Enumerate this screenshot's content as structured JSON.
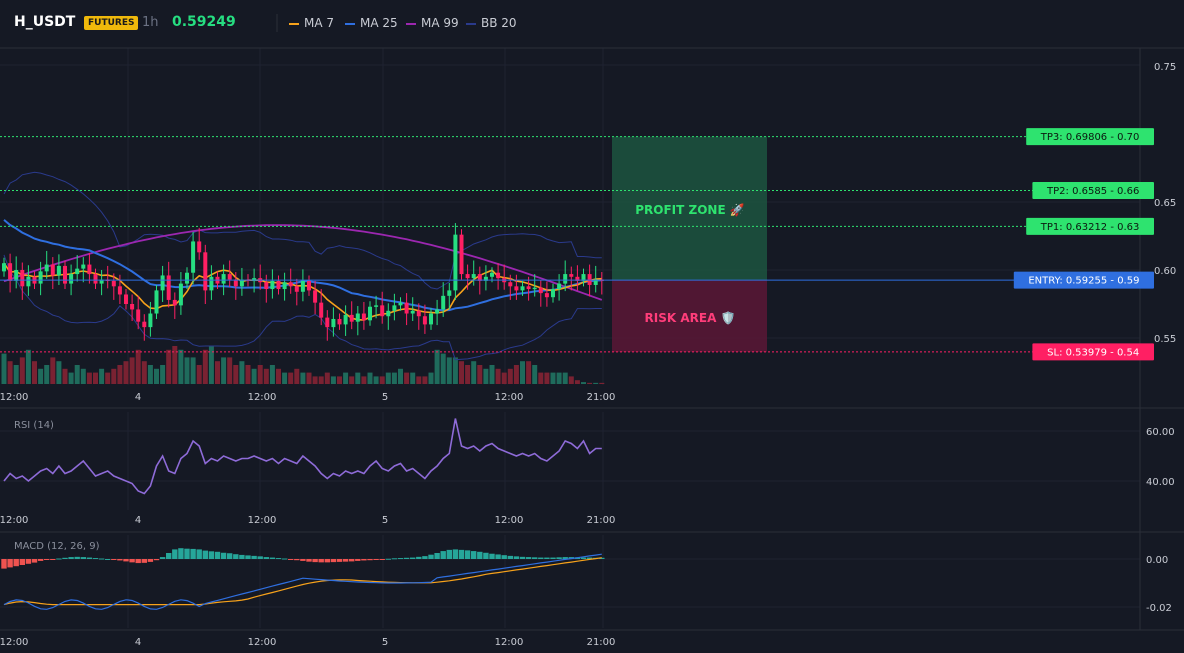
{
  "header": {
    "symbol": "H_USDT",
    "badge": "FUTURES",
    "timeframe": "1h",
    "last_price": "0.59249",
    "legend": [
      {
        "label": "MA 7",
        "color": "#f7a21b"
      },
      {
        "label": "MA 25",
        "color": "#2f6fe0"
      },
      {
        "label": "MA 99",
        "color": "#9c27b0"
      },
      {
        "label": "BB 20",
        "color": "#2a3a8c"
      }
    ]
  },
  "main_axis": {
    "ticks": [
      "0.75",
      "0.65",
      "0.60",
      "0.55"
    ],
    "tick_values": [
      0.75,
      0.65,
      0.6,
      0.55
    ]
  },
  "time_axis": [
    "12:00",
    "4",
    "12:00",
    "5",
    "12:00",
    "21:00"
  ],
  "levels": [
    {
      "id": "tp3",
      "label": "TP3: 0.69806 - 0.70",
      "value": 0.69806,
      "color": "#2ee36f",
      "text_color": "#0b1a10",
      "line": "dotted"
    },
    {
      "id": "tp2",
      "label": "TP2: 0.6585 - 0.66",
      "value": 0.6585,
      "color": "#2ee36f",
      "text_color": "#0b1a10",
      "line": "dotted"
    },
    {
      "id": "tp1",
      "label": "TP1: 0.63212 - 0.63",
      "value": 0.63212,
      "color": "#2ee36f",
      "text_color": "#0b1a10",
      "line": "dotted"
    },
    {
      "id": "entry",
      "label": "ENTRY: 0.59255 - 0.59",
      "value": 0.59255,
      "color": "#2f6fe0",
      "text_color": "#ffffff",
      "line": "solid"
    },
    {
      "id": "sl",
      "label": "SL: 0.53979 - 0.54",
      "value": 0.53979,
      "color": "#ff1f63",
      "text_color": "#ffffff",
      "line": "dotted"
    }
  ],
  "zones": {
    "profit": "PROFIT ZONE 🚀",
    "risk": "RISK AREA 🛡️"
  },
  "rsi": {
    "title": "RSI (14)",
    "ticks": [
      "60.00",
      "40.00"
    ],
    "tick_values": [
      60,
      40
    ],
    "values": [
      40,
      43,
      41,
      42,
      40,
      42,
      44,
      45,
      43,
      46,
      43,
      44,
      46,
      48,
      45,
      42,
      43,
      44,
      42,
      41,
      40,
      39,
      36,
      35,
      38,
      46,
      50,
      44,
      43,
      49,
      51,
      56,
      54,
      47,
      49,
      48,
      50,
      49,
      48,
      49,
      49,
      50,
      49,
      48,
      49,
      47,
      49,
      48,
      47,
      50,
      48,
      46,
      43,
      41,
      43,
      42,
      44,
      43,
      44,
      43,
      46,
      48,
      45,
      44,
      46,
      47,
      44,
      45,
      43,
      41,
      44,
      46,
      49,
      51,
      65,
      54,
      53,
      54,
      52,
      54,
      55,
      53,
      52,
      51,
      50,
      51,
      50,
      51,
      49,
      48,
      50,
      52,
      56,
      55,
      53,
      56,
      51,
      53,
      53
    ]
  },
  "macd": {
    "title": "MACD (12, 26, 9)",
    "ticks": [
      "0.00",
      "-0.02"
    ],
    "tick_values": [
      0.0,
      -0.02
    ]
  },
  "chart_data": [
    {
      "type": "candlestick",
      "title": "H_USDT",
      "xlabel": "",
      "ylabel": "",
      "ylim": [
        0.525,
        0.76
      ],
      "x_ticks": [
        "12:00",
        "4",
        "12:00",
        "5",
        "12:00",
        "21:00"
      ],
      "closes": [
        0.605,
        0.592,
        0.6,
        0.588,
        0.595,
        0.59,
        0.599,
        0.604,
        0.596,
        0.603,
        0.59,
        0.597,
        0.601,
        0.604,
        0.597,
        0.59,
        0.593,
        0.592,
        0.588,
        0.582,
        0.575,
        0.571,
        0.562,
        0.558,
        0.568,
        0.585,
        0.596,
        0.578,
        0.574,
        0.59,
        0.598,
        0.621,
        0.613,
        0.585,
        0.595,
        0.59,
        0.597,
        0.593,
        0.588,
        0.593,
        0.592,
        0.594,
        0.591,
        0.586,
        0.592,
        0.586,
        0.591,
        0.588,
        0.584,
        0.592,
        0.585,
        0.576,
        0.565,
        0.558,
        0.564,
        0.56,
        0.567,
        0.562,
        0.568,
        0.563,
        0.573,
        0.574,
        0.566,
        0.57,
        0.574,
        0.576,
        0.568,
        0.57,
        0.566,
        0.56,
        0.568,
        0.571,
        0.581,
        0.585,
        0.626,
        0.597,
        0.594,
        0.597,
        0.592,
        0.595,
        0.598,
        0.594,
        0.591,
        0.588,
        0.585,
        0.588,
        0.586,
        0.587,
        0.583,
        0.58,
        0.586,
        0.59,
        0.597,
        0.595,
        0.592,
        0.597,
        0.589,
        0.593,
        0.592
      ],
      "volumes": [
        0.8,
        0.6,
        0.5,
        0.7,
        0.9,
        0.6,
        0.4,
        0.5,
        0.7,
        0.6,
        0.4,
        0.3,
        0.5,
        0.4,
        0.3,
        0.3,
        0.4,
        0.3,
        0.4,
        0.5,
        0.6,
        0.7,
        0.9,
        0.6,
        0.5,
        0.4,
        0.5,
        0.9,
        1.0,
        0.9,
        0.7,
        0.7,
        0.5,
        0.9,
        1.0,
        0.6,
        0.7,
        0.7,
        0.5,
        0.6,
        0.5,
        0.4,
        0.5,
        0.4,
        0.5,
        0.4,
        0.3,
        0.3,
        0.4,
        0.3,
        0.3,
        0.2,
        0.2,
        0.3,
        0.2,
        0.2,
        0.3,
        0.2,
        0.3,
        0.2,
        0.3,
        0.2,
        0.2,
        0.3,
        0.3,
        0.4,
        0.3,
        0.3,
        0.2,
        0.2,
        0.3,
        0.9,
        0.8,
        0.7,
        0.7,
        0.6,
        0.5,
        0.6,
        0.5,
        0.4,
        0.5,
        0.4,
        0.3,
        0.4,
        0.5,
        0.6,
        0.6,
        0.5,
        0.3,
        0.3,
        0.3,
        0.3,
        0.3,
        0.2,
        0.1,
        0.05,
        0.03,
        0.03,
        0.03
      ],
      "series": [
        {
          "name": "MA 7",
          "color": "#f7a21b"
        },
        {
          "name": "MA 25",
          "color": "#2f6fe0"
        },
        {
          "name": "MA 99",
          "color": "#9c27b0"
        },
        {
          "name": "BB 20",
          "color": "#2a3a8c"
        }
      ]
    },
    {
      "type": "line",
      "title": "RSI (14)",
      "ylim": [
        32,
        68
      ],
      "y_ticks": [
        "60.00",
        "40.00"
      ]
    },
    {
      "type": "bar",
      "title": "MACD (12, 26, 9)",
      "ylim": [
        -0.028,
        0.006
      ],
      "y_ticks": [
        "0.00",
        "-0.02"
      ],
      "histogram": [
        -0.004,
        -0.0035,
        -0.003,
        -0.0025,
        -0.002,
        -0.0015,
        -0.0008,
        -0.0004,
        -0.0002,
        0.0002,
        0.0005,
        0.0008,
        0.0009,
        0.0008,
        0.0006,
        0.0004,
        0.0002,
        0.0,
        -0.0003,
        -0.0006,
        -0.001,
        -0.0014,
        -0.0017,
        -0.0016,
        -0.0012,
        -0.0005,
        0.0008,
        0.0025,
        0.004,
        0.0045,
        0.0043,
        0.0042,
        0.004,
        0.0035,
        0.0032,
        0.003,
        0.0026,
        0.0024,
        0.002,
        0.0017,
        0.0015,
        0.0013,
        0.0011,
        0.0008,
        0.0006,
        0.0004,
        0.0002,
        -0.0002,
        -0.0005,
        -0.0008,
        -0.0011,
        -0.0013,
        -0.0014,
        -0.0014,
        -0.0013,
        -0.0012,
        -0.0011,
        -0.001,
        -0.0008,
        -0.0006,
        -0.0005,
        -0.0003,
        -0.0001,
        0.0001,
        0.0003,
        0.0004,
        0.0005,
        0.0006,
        0.0009,
        0.0012,
        0.0018,
        0.0025,
        0.0033,
        0.0038,
        0.004,
        0.0038,
        0.0036,
        0.0033,
        0.003,
        0.0026,
        0.0022,
        0.0019,
        0.0016,
        0.0013,
        0.0011,
        0.0009,
        0.0008,
        0.0007,
        0.0006,
        0.0006,
        0.0006,
        0.0007,
        0.0008,
        0.0008,
        0.0007,
        0.0006,
        0.0006,
        0.0005,
        0.0005
      ]
    }
  ]
}
